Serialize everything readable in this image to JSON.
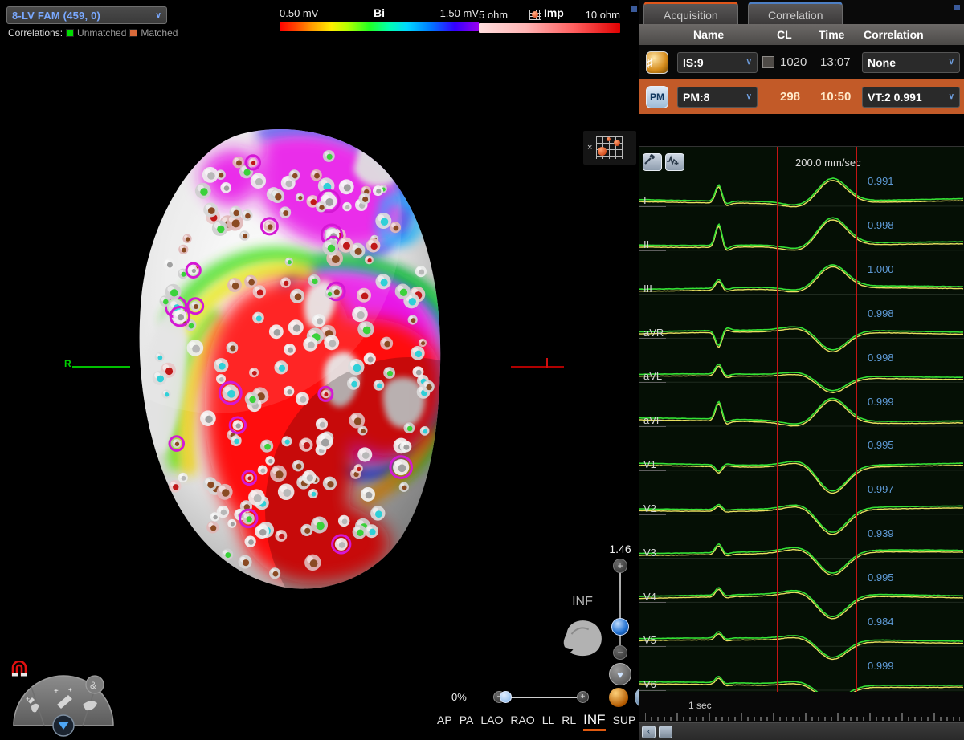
{
  "map": {
    "selector_label": "8-LV FAM (459, 0)",
    "selector_chevron": "∨",
    "correlations_label": "Correlations:",
    "legend_unmatched": "Unmatched",
    "legend_matched": "Matched",
    "color_unmatched": "#00dd00",
    "color_matched": "#d86a3a",
    "axis_right_letter": "R",
    "inf_caption": "INF",
    "mini_legend_close": "×"
  },
  "scales": {
    "bipolar": {
      "min": "0.50 mV",
      "label": "Bi",
      "max": "1.50 mV"
    },
    "impedance": {
      "min": "5 ohm",
      "label": "Imp",
      "max": "10 ohm"
    }
  },
  "zoom_control": {
    "value": "1.46",
    "plus": "+",
    "minus": "−",
    "home_icon": "♥"
  },
  "view_bar": {
    "percent": "0%",
    "minus": "−",
    "plus": "+",
    "views": [
      "AP",
      "PA",
      "LAO",
      "RAO",
      "LL",
      "RL",
      "INF",
      "SUP"
    ],
    "active_view": "INF"
  },
  "right_panel": {
    "tabs": [
      {
        "label": "Acquisition",
        "active": true
      },
      {
        "label": "Correlation",
        "active": false
      }
    ],
    "columns": [
      "Name",
      "CL",
      "Time",
      "Correlation"
    ],
    "rows": [
      {
        "icon": "map-target-icon",
        "icon_text": "♯",
        "name": "IS:9",
        "has_checkbox": true,
        "cl": "1020",
        "time": "13:07",
        "correlation": "None",
        "selected": false
      },
      {
        "icon": "pacemap-icon",
        "icon_text": "PM",
        "name": "PM:8",
        "has_checkbox": false,
        "cl": "298",
        "time": "10:50",
        "correlation": "VT:2  0.991",
        "selected": true
      }
    ],
    "chevron": "∨"
  },
  "ecg": {
    "sweep_speed": "200.0 mm/sec",
    "time_label": "1 sec",
    "leads": [
      {
        "name": "I",
        "correlation": "0.991"
      },
      {
        "name": "II",
        "correlation": "0.998"
      },
      {
        "name": "III",
        "correlation": "1.000"
      },
      {
        "name": "aVR",
        "correlation": "0.998"
      },
      {
        "name": "aVL",
        "correlation": "0.998"
      },
      {
        "name": "aVF",
        "correlation": "0.999"
      },
      {
        "name": "V1",
        "correlation": "0.995"
      },
      {
        "name": "V2",
        "correlation": "0.997"
      },
      {
        "name": "V3",
        "correlation": "0.939"
      },
      {
        "name": "V4",
        "correlation": "0.995"
      },
      {
        "name": "V5",
        "correlation": "0.984"
      },
      {
        "name": "V6",
        "correlation": "0.999"
      }
    ],
    "trace_color_reference": "#e8e060",
    "trace_color_current": "#35e035",
    "caliper_color": "#c41414"
  },
  "nav": {
    "prev": "‹",
    "stop": ""
  }
}
